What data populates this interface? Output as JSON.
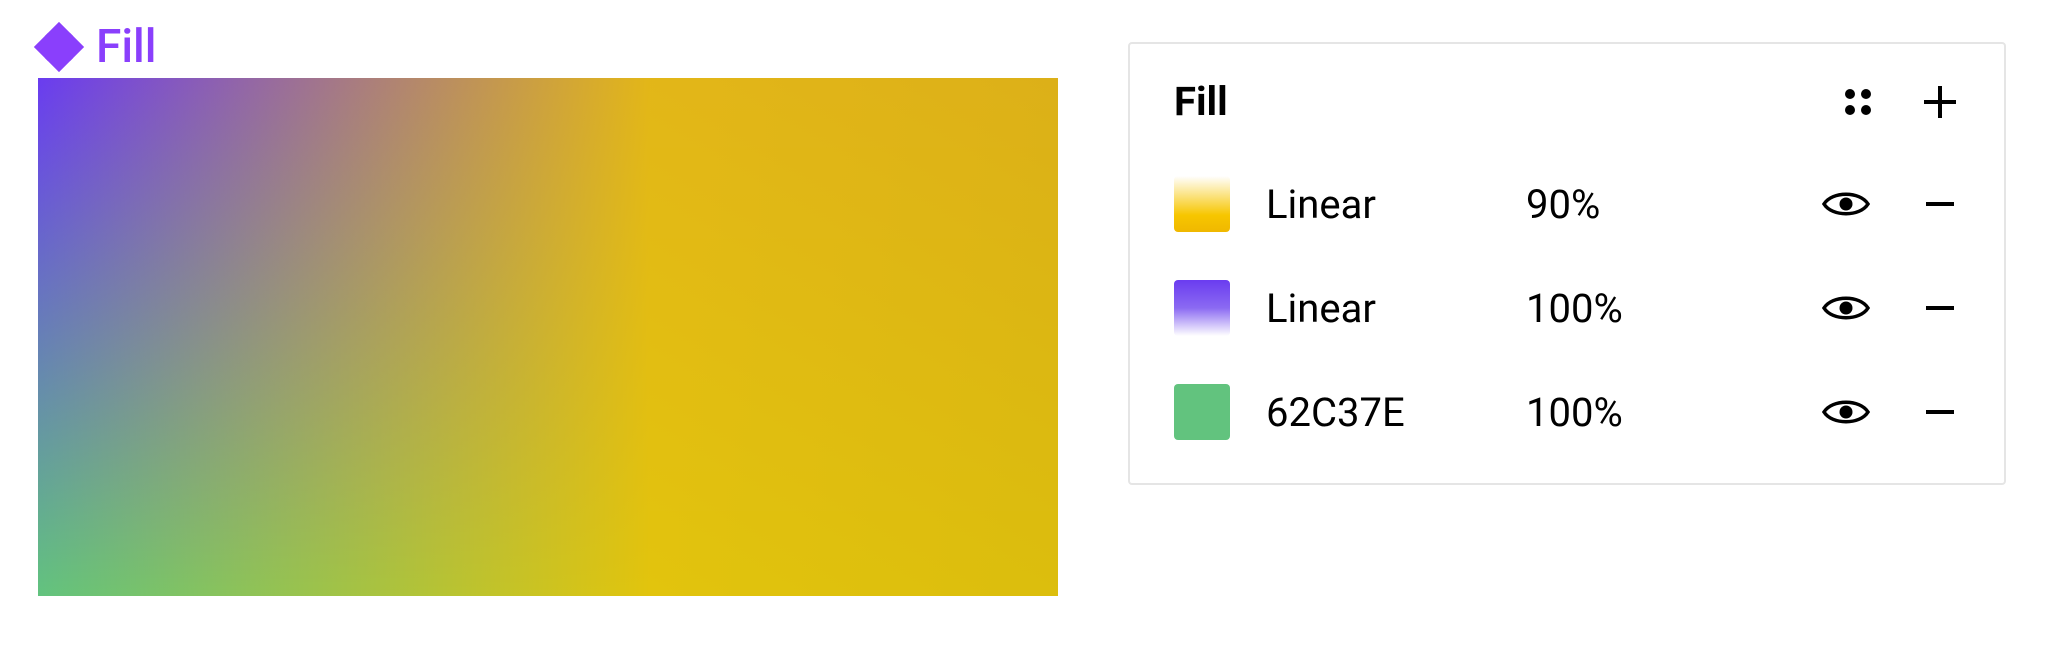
{
  "canvas": {
    "label": "Fill"
  },
  "panel": {
    "title": "Fill",
    "fills": [
      {
        "name": "Linear",
        "opacity": "90%"
      },
      {
        "name": "Linear",
        "opacity": "100%"
      },
      {
        "name": "62C37E",
        "opacity": "100%"
      }
    ]
  },
  "colors": {
    "accent_purple": "#8a3ffc",
    "gradient_purple": "#6a3cf0",
    "gradient_yellow": "#f0c400",
    "solid_green": "#62C37E"
  }
}
